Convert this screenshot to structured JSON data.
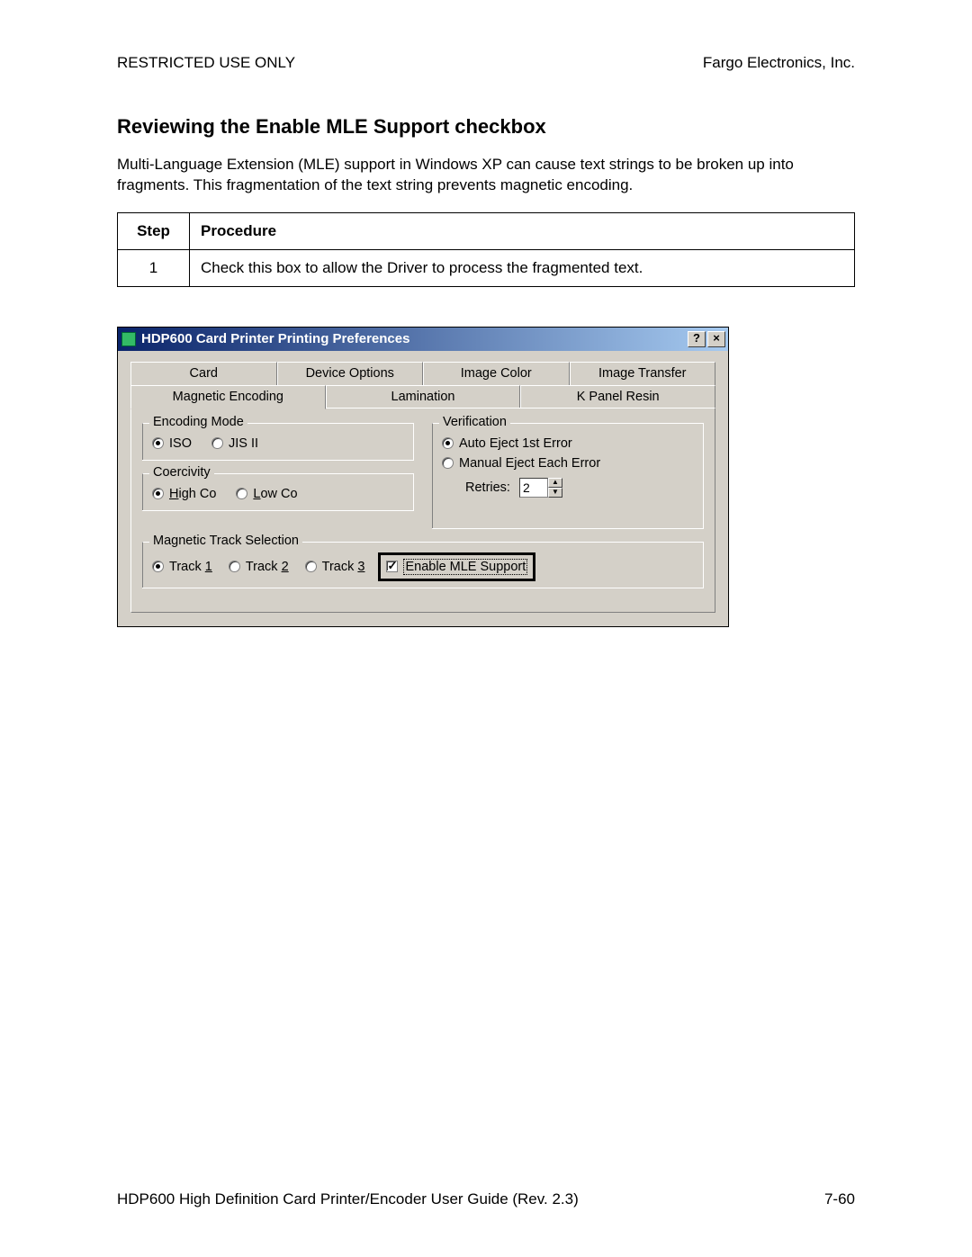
{
  "header": {
    "left": "RESTRICTED USE ONLY",
    "right": "Fargo Electronics, Inc."
  },
  "section": {
    "title": "Reviewing the Enable MLE Support checkbox",
    "body": "Multi-Language Extension (MLE) support in Windows XP can cause text strings to be broken up into fragments. This fragmentation of the text string prevents magnetic encoding."
  },
  "table": {
    "head_step": "Step",
    "head_proc": "Procedure",
    "rows": [
      {
        "step": "1",
        "proc": "Check this box to allow the Driver to process the fragmented text."
      }
    ]
  },
  "dialog": {
    "title": "HDP600 Card Printer Printing Preferences",
    "help_btn": "?",
    "close_btn": "×",
    "tabs_top": [
      "Card",
      "Device Options",
      "Image Color",
      "Image Transfer"
    ],
    "tabs_bottom": [
      "Magnetic Encoding",
      "Lamination",
      "K Panel Resin"
    ],
    "encoding_mode": {
      "legend": "Encoding Mode",
      "iso": "ISO",
      "jis": "JIS II"
    },
    "coercivity": {
      "legend": "Coercivity",
      "high": "High Co",
      "low": "Low Co"
    },
    "verification": {
      "legend": "Verification",
      "auto": "Auto Eject 1st Error",
      "manual": "Manual Eject Each Error",
      "retries_label": "Retries:",
      "retries_value": "2"
    },
    "track": {
      "legend": "Magnetic Track Selection",
      "t1": "Track 1",
      "t2": "Track 2",
      "t3": "Track 3",
      "mle": "Enable MLE Support"
    }
  },
  "footer": {
    "left": "HDP600 High Definition Card Printer/Encoder User Guide (Rev. 2.3)",
    "right": "7-60"
  }
}
